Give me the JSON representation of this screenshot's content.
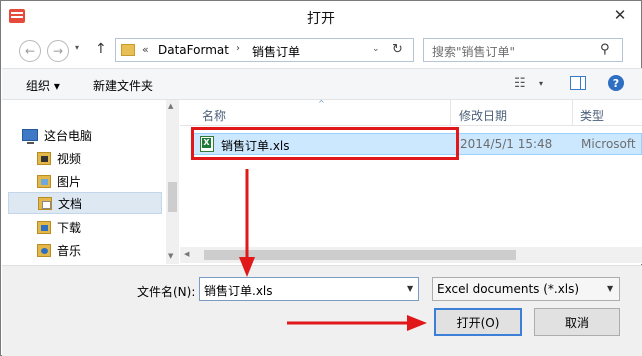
{
  "window": {
    "title": "打开",
    "close_glyph": "✕"
  },
  "address_bar": {
    "back_glyph": "←",
    "forward_glyph": "→",
    "history_glyph": "▾",
    "up_glyph": "↑",
    "separator": "«",
    "segments": [
      "DataFormat",
      "销售订单"
    ],
    "chevron": "›",
    "dropdown_glyph": "⌄",
    "refresh_glyph": "↻"
  },
  "search": {
    "placeholder": "搜索\"销售订单\"",
    "icon_glyph": "⚲"
  },
  "toolbar": {
    "organize_label": "组织 ▾",
    "new_folder_label": "新建文件夹",
    "view_glyph": "☷",
    "view_drop_glyph": "▾",
    "help_glyph": "?"
  },
  "nav_pane": {
    "items": [
      {
        "label": "这台电脑",
        "icon": "computer-icon"
      },
      {
        "label": "视频",
        "icon": "video-folder-icon"
      },
      {
        "label": "图片",
        "icon": "pictures-folder-icon"
      },
      {
        "label": "文档",
        "icon": "documents-folder-icon",
        "selected": true
      },
      {
        "label": "下载",
        "icon": "downloads-folder-icon"
      },
      {
        "label": "音乐",
        "icon": "music-folder-icon"
      }
    ],
    "scroll_up_glyph": "▲",
    "scroll_down_glyph": "▼"
  },
  "file_list": {
    "columns": {
      "name": "名称",
      "date": "修改日期",
      "type": "类型"
    },
    "sort_glyph": "^",
    "rows": [
      {
        "name": "销售订单.xls",
        "date": "2014/5/1 15:48",
        "type": "Microsoft",
        "selected": true
      }
    ],
    "hscroll_left_glyph": "◀"
  },
  "footer": {
    "filename_label": "文件名(N):",
    "filename_value": "销售订单.xls",
    "filter_value": "Excel documents (*.xls)",
    "drop_glyph": "▼",
    "open_label": "打开(O)",
    "cancel_label": "取消"
  },
  "colors": {
    "annotation": "#e0181a",
    "selection": "#cce8ff",
    "accent": "#3c7fd6"
  }
}
